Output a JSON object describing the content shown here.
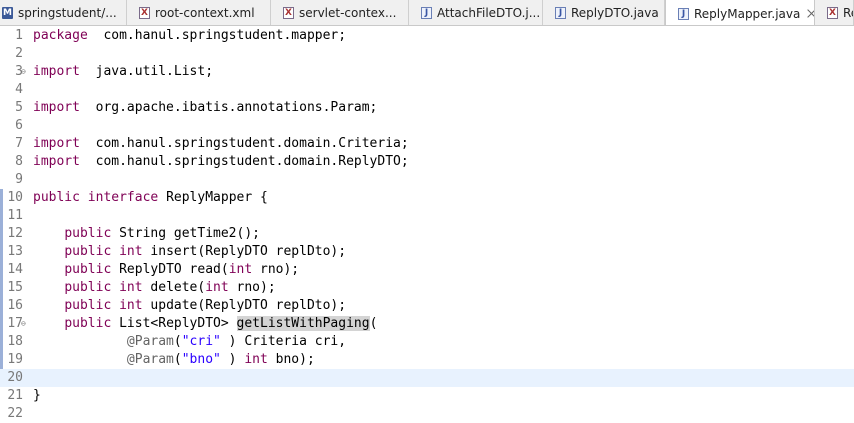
{
  "tabs": [
    {
      "icon": "maven-pom-icon",
      "label": "springstudent/..."
    },
    {
      "icon": "xml-file-icon",
      "label": "root-context.xml"
    },
    {
      "icon": "xml-file-icon",
      "label": "servlet-contex..."
    },
    {
      "icon": "java-file-icon",
      "label": "AttachFileDTO.j..."
    },
    {
      "icon": "java-file-icon",
      "label": "ReplyDTO.java"
    },
    {
      "icon": "java-file-icon",
      "label": "ReplyMapper.java",
      "active": true
    },
    {
      "icon": "xml-file-icon",
      "label": "Re"
    }
  ],
  "editor": {
    "current_line": 20,
    "lines": [
      {
        "n": "1",
        "tokens": [
          [
            "k",
            "package"
          ],
          [
            "",
            "  com.hanul.springstudent.mapper;"
          ]
        ]
      },
      {
        "n": "2",
        "tokens": []
      },
      {
        "n": "3",
        "fold": true,
        "tokens": [
          [
            "k",
            "import"
          ],
          [
            "",
            "  java.util.List;"
          ]
        ]
      },
      {
        "n": "4",
        "tokens": []
      },
      {
        "n": "5",
        "tokens": [
          [
            "k",
            "import"
          ],
          [
            "",
            "  org.apache.ibatis.annotations.Param;"
          ]
        ]
      },
      {
        "n": "6",
        "tokens": []
      },
      {
        "n": "7",
        "tokens": [
          [
            "k",
            "import"
          ],
          [
            "",
            "  com.hanul.springstudent.domain.Criteria;"
          ]
        ]
      },
      {
        "n": "8",
        "tokens": [
          [
            "k",
            "import"
          ],
          [
            "",
            "  com.hanul.springstudent.domain.ReplyDTO;"
          ]
        ]
      },
      {
        "n": "9",
        "tokens": []
      },
      {
        "n": "10",
        "tokens": [
          [
            "k",
            "public"
          ],
          [
            "",
            " "
          ],
          [
            "k",
            "interface"
          ],
          [
            "",
            " ReplyMapper {"
          ]
        ]
      },
      {
        "n": "11",
        "tokens": []
      },
      {
        "n": "12",
        "tokens": [
          [
            "",
            "    "
          ],
          [
            "k",
            "public"
          ],
          [
            "",
            " String getTime2();"
          ]
        ]
      },
      {
        "n": "13",
        "tokens": [
          [
            "",
            "    "
          ],
          [
            "k",
            "public"
          ],
          [
            "",
            " "
          ],
          [
            "k",
            "int"
          ],
          [
            "",
            " insert(ReplyDTO replDto);"
          ]
        ]
      },
      {
        "n": "14",
        "tokens": [
          [
            "",
            "    "
          ],
          [
            "k",
            "public"
          ],
          [
            "",
            " ReplyDTO read("
          ],
          [
            "k",
            "int"
          ],
          [
            "",
            " rno);"
          ]
        ]
      },
      {
        "n": "15",
        "tokens": [
          [
            "",
            "    "
          ],
          [
            "k",
            "public"
          ],
          [
            "",
            " "
          ],
          [
            "k",
            "int"
          ],
          [
            "",
            " delete("
          ],
          [
            "k",
            "int"
          ],
          [
            "",
            " rno);"
          ]
        ]
      },
      {
        "n": "16",
        "tokens": [
          [
            "",
            "    "
          ],
          [
            "k",
            "public"
          ],
          [
            "",
            " "
          ],
          [
            "k",
            "int"
          ],
          [
            "",
            " update(ReplyDTO replDto);"
          ]
        ]
      },
      {
        "n": "17",
        "fold": true,
        "tokens": [
          [
            "",
            "    "
          ],
          [
            "k",
            "public"
          ],
          [
            "",
            " List<ReplyDTO> "
          ],
          [
            "hl",
            "getListWithPaging"
          ],
          [
            "",
            "("
          ]
        ]
      },
      {
        "n": "18",
        "tokens": [
          [
            "",
            "            "
          ],
          [
            "a",
            "@Param"
          ],
          [
            "",
            "("
          ],
          [
            "s",
            "\"cri\""
          ],
          [
            "",
            " ) Criteria cri,"
          ]
        ]
      },
      {
        "n": "19",
        "tokens": [
          [
            "",
            "            "
          ],
          [
            "a",
            "@Param"
          ],
          [
            "",
            "("
          ],
          [
            "s",
            "\"bno\""
          ],
          [
            "",
            " ) "
          ],
          [
            "k",
            "int"
          ],
          [
            "",
            " bno);"
          ]
        ]
      },
      {
        "n": "20",
        "tokens": []
      },
      {
        "n": "21",
        "tokens": [
          [
            "",
            "}"
          ]
        ]
      },
      {
        "n": "22",
        "tokens": []
      }
    ]
  }
}
